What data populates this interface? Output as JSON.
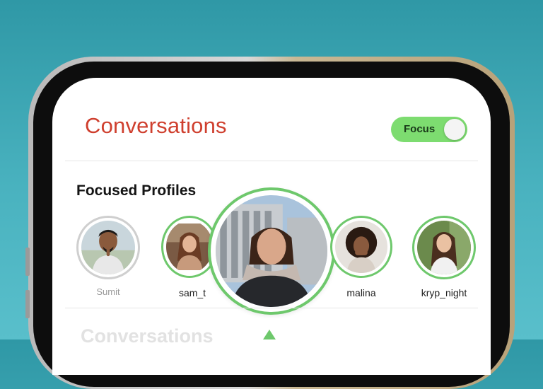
{
  "header": {
    "title": "Conversations",
    "focus_toggle": {
      "label": "Focus",
      "state": "on"
    }
  },
  "focused_profiles": {
    "title": "Focused Profiles",
    "profiles": [
      {
        "name": "Sumit",
        "ring": "grey"
      },
      {
        "name": "sam_t",
        "ring": "green"
      },
      {
        "name": "",
        "ring": "green",
        "selected": true
      },
      {
        "name": "malina",
        "ring": "green"
      },
      {
        "name": "kryp_night",
        "ring": "green"
      }
    ]
  },
  "lower_section": {
    "title": "Conversations"
  },
  "colors": {
    "background": "#49b2bf",
    "title_red": "#cf3f2e",
    "toggle_green": "#7ddc70",
    "ring_green": "#6ec86c",
    "ring_grey": "#cfcfcf"
  }
}
